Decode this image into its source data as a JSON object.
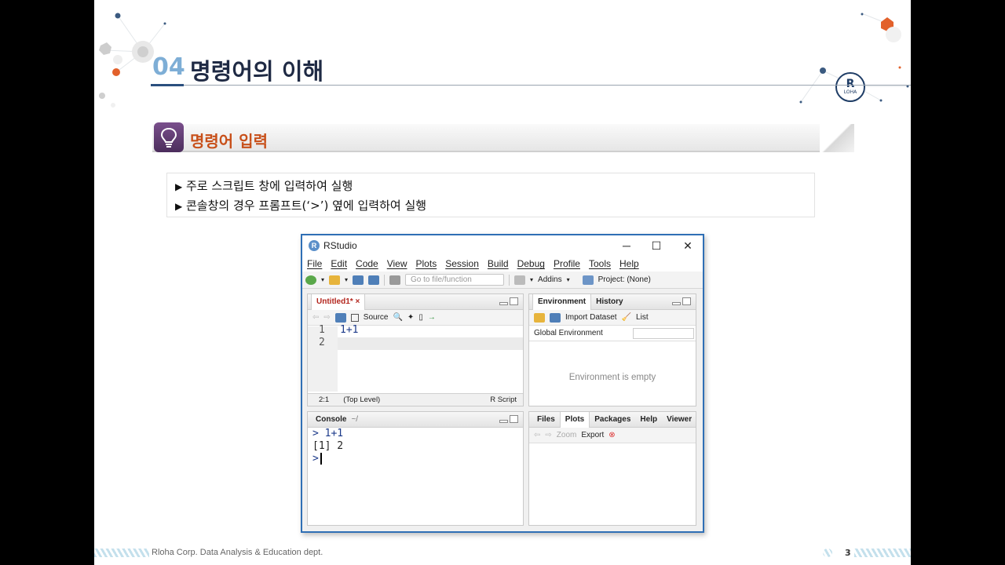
{
  "slide": {
    "title_number": "04",
    "title": "명령어의 이해",
    "logo_letter": "R",
    "logo_text": "LOHA",
    "section_title": "명령어 입력",
    "bullets": [
      "주로 스크립트 창에 입력하여 실행",
      "콘솔창의 경우 프롬프트(‘>’) 옆에 입력하여 실행"
    ],
    "footer": "Rloha Corp. Data Analysis & Education dept.",
    "page_number": "3",
    "colors": {
      "accent_orange": "#c8501a",
      "title_blue": "#7eaed6",
      "navy": "#1f2a44"
    }
  },
  "rstudio": {
    "window_title": "RStudio",
    "menu": [
      "File",
      "Edit",
      "Code",
      "View",
      "Plots",
      "Session",
      "Build",
      "Debug",
      "Profile",
      "Tools",
      "Help"
    ],
    "toolbar": {
      "goto_placeholder": "Go to file/function",
      "addins": "Addins",
      "project": "Project: (None)"
    },
    "editor": {
      "tab": "Untitled1*",
      "source_label": "Source",
      "lines": [
        "1+1",
        ""
      ],
      "line_numbers": [
        "1",
        "2"
      ],
      "status_pos": "2:1",
      "status_scope": "(Top Level)",
      "status_type": "R Script"
    },
    "environment": {
      "tabs": [
        "Environment",
        "History"
      ],
      "import": "Import Dataset",
      "list": "List",
      "scope": "Global Environment",
      "empty": "Environment is empty"
    },
    "console": {
      "tab": "Console",
      "path": "~/",
      "lines": [
        {
          "prefix": ">",
          "text": "1+1"
        },
        {
          "prefix": "",
          "text": "[1] 2"
        },
        {
          "prefix": ">",
          "text": ""
        }
      ]
    },
    "files": {
      "tabs": [
        "Files",
        "Plots",
        "Packages",
        "Help",
        "Viewer"
      ],
      "active_tab": "Plots",
      "zoom": "Zoom",
      "export": "Export"
    }
  }
}
